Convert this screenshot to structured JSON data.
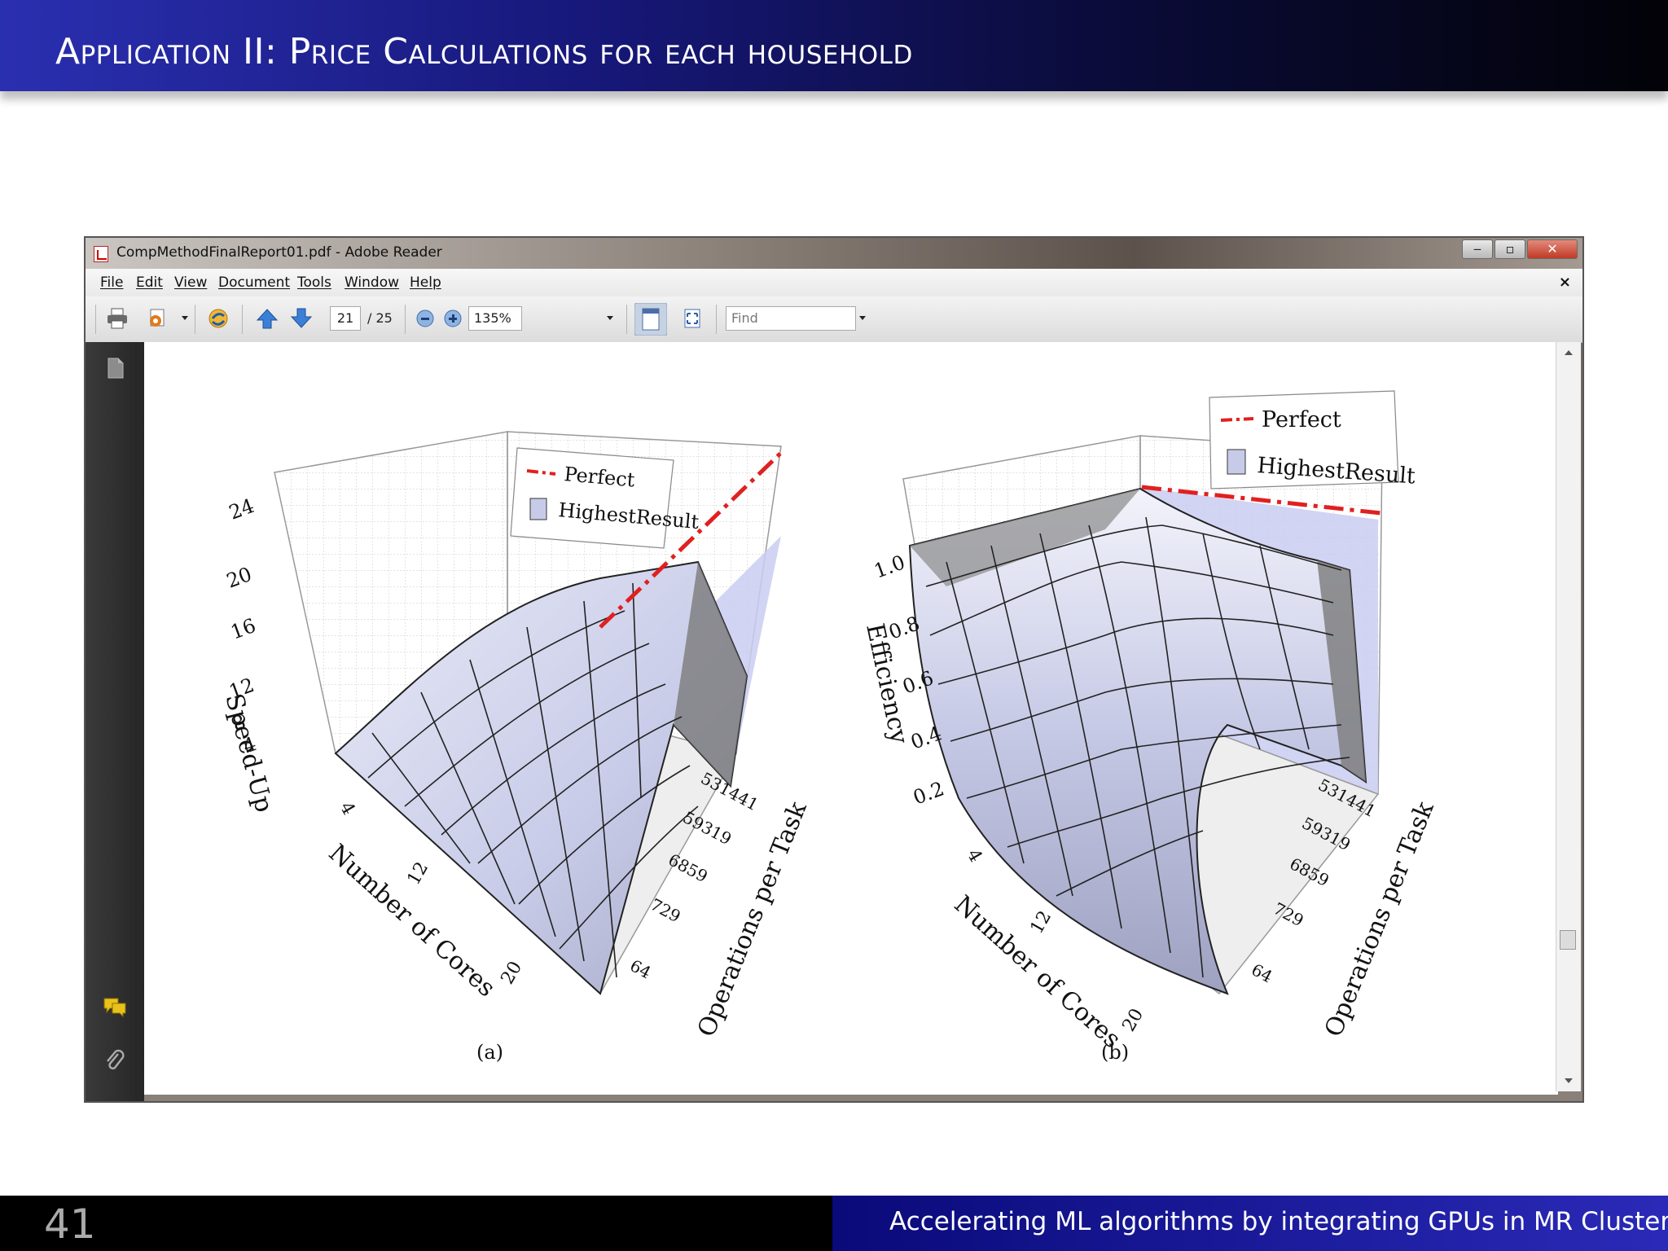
{
  "slide": {
    "title": "Application II: Price Calculations for each household",
    "slide_number": "41",
    "footer_text": "Accelerating ML algorithms by integrating GPUs in MR Clusters",
    "colors": {
      "header_start": "#2a2fb0",
      "header_end": "#020207",
      "footer_accent": "#2a2ab8"
    }
  },
  "window": {
    "title": "CompMethodFinalReport01.pdf - Adobe Reader",
    "controls": {
      "minimize": "‒",
      "maximize": "▫",
      "close": "✕"
    }
  },
  "menu": {
    "items": [
      "File",
      "Edit",
      "View",
      "Document",
      "Tools",
      "Window",
      "Help"
    ],
    "close": "×"
  },
  "toolbar": {
    "page_current": "21",
    "page_total": "/ 25",
    "zoom": "135%",
    "find_placeholder": "Find",
    "icons": [
      "print-icon",
      "create-pdf-icon",
      "share-icon",
      "previous-page-icon",
      "next-page-icon",
      "zoom-out-icon",
      "zoom-in-icon",
      "fit-width-icon",
      "full-screen-icon"
    ]
  },
  "sidebar": {
    "icons": [
      "pages-icon",
      "comments-icon",
      "attachments-icon"
    ]
  },
  "chart_data": [
    {
      "type": "surface",
      "caption": "(a)",
      "zlabel": "Speed-Up",
      "xlabel": "Number of Cores",
      "ylabel": "Operations per Task",
      "z_ticks": [
        "4",
        "8",
        "12",
        "16",
        "20",
        "24"
      ],
      "x_ticks": [
        "4",
        "12",
        "20"
      ],
      "y_ticks": [
        "64",
        "729",
        "6859",
        "59319",
        "531441"
      ],
      "legend": [
        "Perfect",
        "HighestResult"
      ],
      "perfect_color": "#e02020",
      "surface_color": "#c8cbe8"
    },
    {
      "type": "surface",
      "caption": "(b)",
      "zlabel": "Efficiency",
      "xlabel": "Number of Cores",
      "ylabel": "Operations per Task",
      "z_ticks": [
        "0.2",
        "0.4",
        "0.6",
        "0.8",
        "1.0"
      ],
      "x_ticks": [
        "4",
        "12",
        "20"
      ],
      "y_ticks": [
        "64",
        "729",
        "6859",
        "59319",
        "531441"
      ],
      "legend": [
        "Perfect",
        "HighestResult"
      ],
      "perfect_color": "#e02020",
      "surface_color": "#c8cbe8"
    }
  ]
}
